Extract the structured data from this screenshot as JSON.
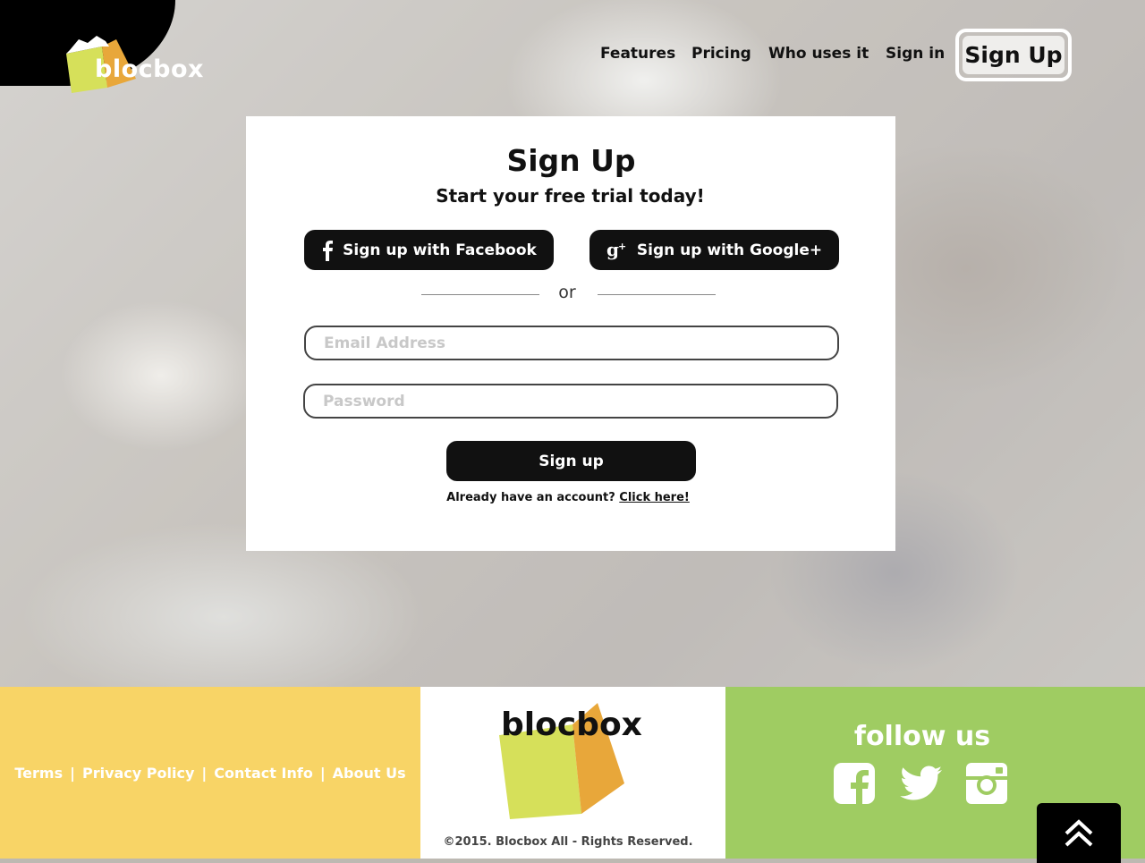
{
  "brand": {
    "name": "blocbox"
  },
  "nav": {
    "features": "Features",
    "pricing": "Pricing",
    "who_uses_it": "Who uses it",
    "sign_in": "Sign in",
    "sign_up": "Sign Up"
  },
  "signup_card": {
    "title": "Sign Up",
    "subtitle": "Start your free trial today!",
    "facebook_label": "Sign up with Facebook",
    "google_label": "Sign up with Google+",
    "or_label": "or",
    "email_placeholder": "Email Address",
    "password_placeholder": "Password",
    "submit_label": "Sign up",
    "already_text": "Already have an account?",
    "click_here": "Click here!"
  },
  "footer": {
    "links": [
      "Terms",
      "|",
      "Privacy Policy",
      "|",
      "Contact Info",
      "|",
      "About Us"
    ],
    "brand": "blocbox",
    "copyright": "©2015. Blocbox All - Rights Reserved.",
    "follow_us": "follow us",
    "social_icons": [
      "facebook-icon",
      "twitter-icon",
      "instagram-icon"
    ]
  },
  "colors": {
    "footer_yellow": "#f8d466",
    "footer_green": "#9fcc62",
    "logo_lime": "#d6e05a",
    "logo_orange": "#e8a73a",
    "button_dark": "#111111"
  }
}
